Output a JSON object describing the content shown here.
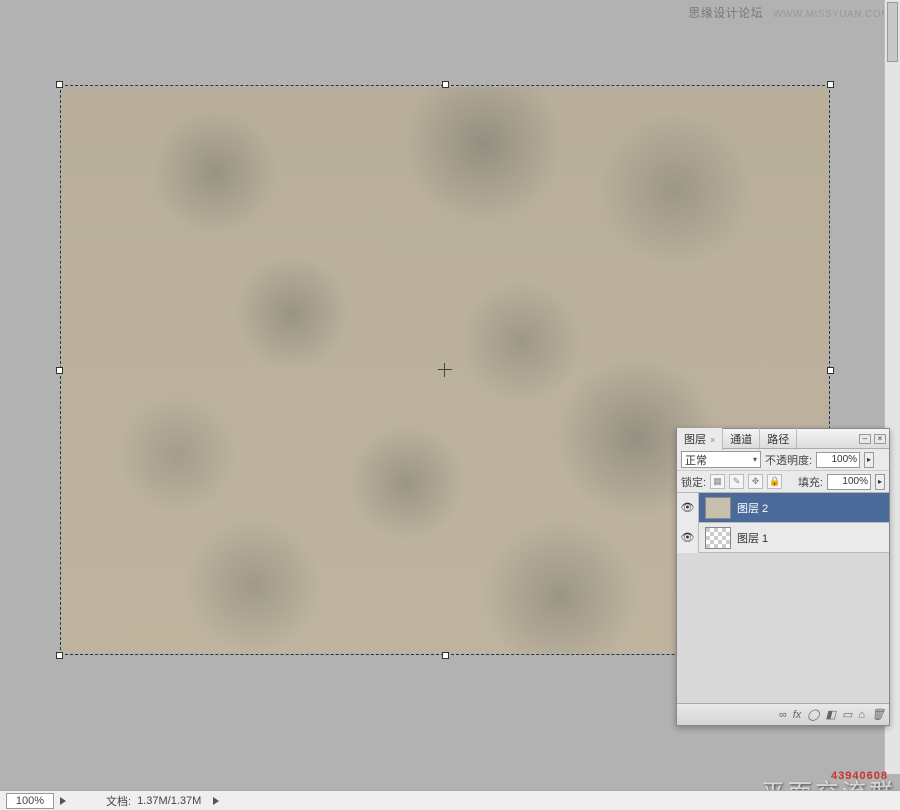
{
  "watermark": {
    "forum": "思缘设计论坛",
    "url": "WWW.MISSYUAN.COM"
  },
  "panel": {
    "tabs": {
      "layers": "图层",
      "channels": "通道",
      "paths": "路径"
    },
    "blend_mode": "正常",
    "opacity_label": "不透明度:",
    "opacity_value": "100%",
    "lock_label": "锁定:",
    "fill_label": "填充:",
    "fill_value": "100%"
  },
  "layers": [
    {
      "name": "图层 2",
      "active": true,
      "checker": false
    },
    {
      "name": "图层 1",
      "active": false,
      "checker": true
    }
  ],
  "footer_icons": [
    "∞",
    "fx",
    "◯",
    "◧",
    "▭",
    "⌂",
    "🗑"
  ],
  "status": {
    "zoom": "100%",
    "doc_label": "文档:",
    "doc_size": "1.37M/1.37M"
  },
  "overlay": {
    "number": "43940608",
    "text": "平面交流群"
  }
}
